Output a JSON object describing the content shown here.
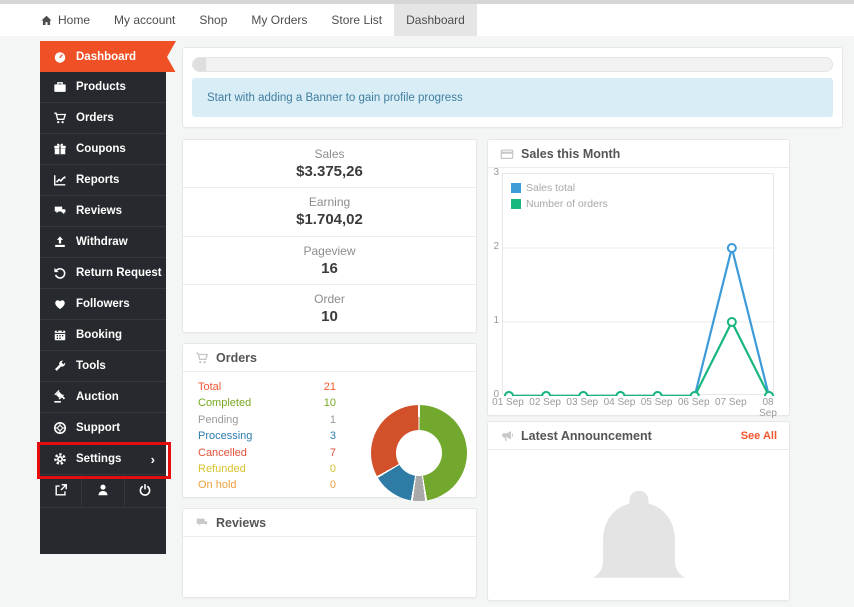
{
  "topnav": {
    "items": [
      {
        "label": "Home"
      },
      {
        "label": "My account"
      },
      {
        "label": "Shop"
      },
      {
        "label": "My Orders"
      },
      {
        "label": "Store List"
      },
      {
        "label": "Dashboard",
        "active": true
      }
    ]
  },
  "sidebar": {
    "items": [
      {
        "label": "Dashboard",
        "icon": "speedometer",
        "active": true
      },
      {
        "label": "Products",
        "icon": "briefcase"
      },
      {
        "label": "Orders",
        "icon": "cart"
      },
      {
        "label": "Coupons",
        "icon": "gift"
      },
      {
        "label": "Reports",
        "icon": "chart-line"
      },
      {
        "label": "Reviews",
        "icon": "comments"
      },
      {
        "label": "Withdraw",
        "icon": "upload"
      },
      {
        "label": "Return Request",
        "icon": "rotate-left"
      },
      {
        "label": "Followers",
        "icon": "heart"
      },
      {
        "label": "Booking",
        "icon": "calendar"
      },
      {
        "label": "Tools",
        "icon": "wrench"
      },
      {
        "label": "Auction",
        "icon": "gavel"
      },
      {
        "label": "Support",
        "icon": "life-ring"
      },
      {
        "label": "Settings",
        "icon": "gear",
        "chevron": "›",
        "annotated": true
      }
    ],
    "footer_icons": [
      "external-link",
      "user",
      "power"
    ]
  },
  "profile_progress": {
    "progress_percent": 2,
    "notice": "Start with adding a Banner to gain profile progress"
  },
  "stats": {
    "items": [
      {
        "label": "Sales",
        "value": "$3.375,26"
      },
      {
        "label": "Earning",
        "value": "$1.704,02"
      },
      {
        "label": "Pageview",
        "value": "16"
      },
      {
        "label": "Order",
        "value": "10"
      }
    ]
  },
  "orders_panel": {
    "title": "Orders",
    "rows": [
      {
        "label": "Total",
        "value": 21,
        "color": "#f1572f"
      },
      {
        "label": "Completed",
        "value": 10,
        "color": "#76a821"
      },
      {
        "label": "Pending",
        "value": 1,
        "color": "#9b9b9b"
      },
      {
        "label": "Processing",
        "value": 3,
        "color": "#2d7cab"
      },
      {
        "label": "Cancelled",
        "value": 7,
        "color": "#e25238"
      },
      {
        "label": "Refunded",
        "value": 0,
        "color": "#d8c22e"
      },
      {
        "label": "On hold",
        "value": 0,
        "color": "#ec9f3e"
      }
    ]
  },
  "chart_panel": {
    "title": "Sales this Month"
  },
  "announcement_panel": {
    "title": "Latest Announcement",
    "see_all": "See All"
  },
  "reviews_panel": {
    "title": "Reviews"
  },
  "chart_data": [
    {
      "type": "line",
      "title": "Sales this Month",
      "x_labels": [
        "01 Sep",
        "02 Sep",
        "03 Sep",
        "04 Sep",
        "05 Sep",
        "06 Sep",
        "07 Sep",
        "08 Sep"
      ],
      "ylim": [
        0,
        3
      ],
      "yticks": [
        0,
        1,
        2,
        3
      ],
      "grid": true,
      "legend_position": "top-left-inside",
      "series": [
        {
          "name": "Sales total",
          "color": "#3d9bd8",
          "values": [
            0,
            0,
            0,
            0,
            0,
            0,
            2,
            0
          ]
        },
        {
          "name": "Number of orders",
          "color": "#17b77e",
          "values": [
            0,
            0,
            0,
            0,
            0,
            0,
            1,
            0
          ]
        }
      ]
    },
    {
      "type": "pie",
      "title": "Orders status donut",
      "labels": [
        "Completed",
        "Pending",
        "Processing",
        "Cancelled"
      ],
      "values": [
        10,
        1,
        3,
        7
      ],
      "colors": [
        "#72a82d",
        "#a9a9a9",
        "#2e7ca5",
        "#d2502a"
      ]
    }
  ],
  "colors": {
    "accent_orange": "#f05025",
    "annotation_red": "#e30d0d",
    "sidebar_bg": "#26292d",
    "notice_bg": "#d9edf7",
    "notice_text": "#3f7e9e"
  }
}
